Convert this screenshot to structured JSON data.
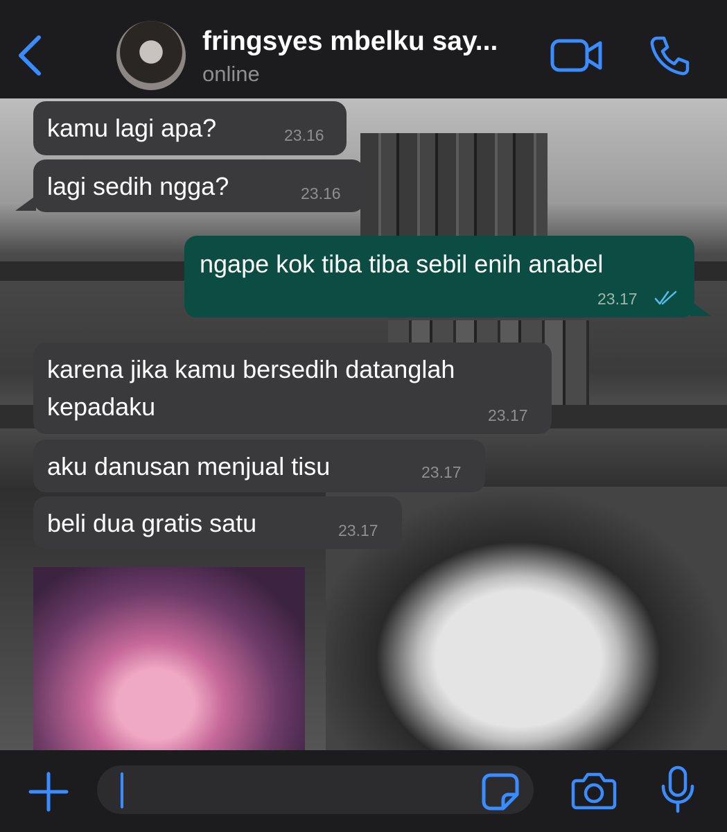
{
  "header": {
    "back_icon": "chevron-left-icon",
    "avatar_icon": "avatar",
    "title": "fringsyes mbelku say...",
    "status": "online",
    "video_icon": "video-camera-icon",
    "call_icon": "phone-icon"
  },
  "messages": [
    {
      "direction": "in",
      "text": "kamu lagi apa?",
      "time": "23.16"
    },
    {
      "direction": "in",
      "text": "lagi sedih ngga?",
      "time": "23.16"
    },
    {
      "direction": "out",
      "text": "ngape kok tiba tiba sebil enih anabel",
      "time": "23.17",
      "read": true
    },
    {
      "direction": "in",
      "text_line1": "karena jika kamu bersedih datanglah",
      "text_line2": "kepadaku",
      "time": "23.17"
    },
    {
      "direction": "in",
      "text": "aku danusan menjual tisu",
      "time": "23.17"
    },
    {
      "direction": "in",
      "text": "beli dua gratis satu",
      "time": "23.17"
    },
    {
      "direction": "in",
      "type": "sticker"
    }
  ],
  "input": {
    "placeholder": "",
    "value": "",
    "plus_icon": "plus-icon",
    "sticker_icon": "sticker-icon",
    "camera_icon": "camera-icon",
    "mic_icon": "microphone-icon"
  },
  "colors": {
    "accent": "#3b8cff",
    "incoming_bubble": "#3a3a3c",
    "outgoing_bubble": "#0b4c43",
    "bar_background": "#1c1c1e"
  }
}
